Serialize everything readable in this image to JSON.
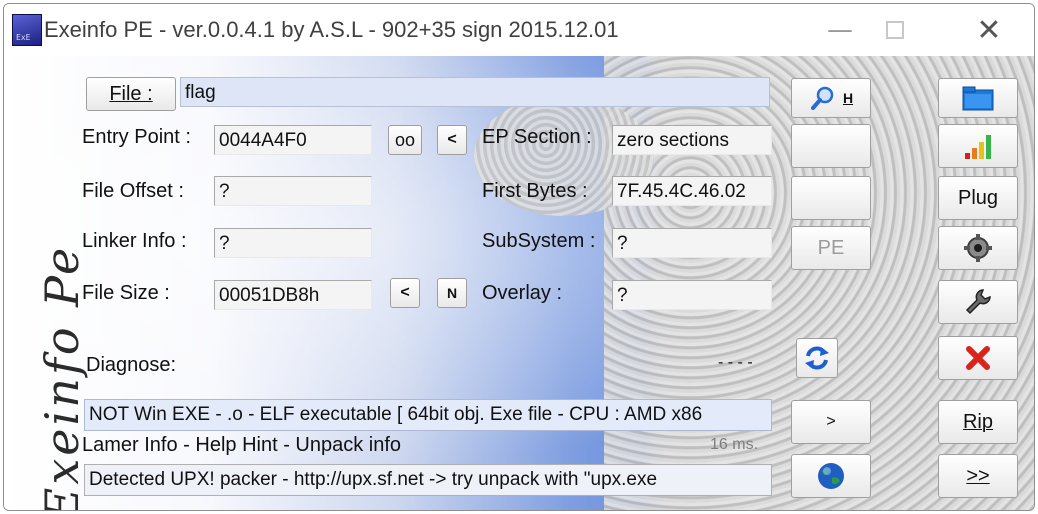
{
  "window": {
    "title": "Exeinfo PE - ver.0.0.4.1  by A.S.L -  902+35 sign  2015.12.01",
    "app_icon_text": "ExE",
    "min_glyph": "—",
    "close_glyph": "✕"
  },
  "logo": {
    "text": "Exeinfo Pe"
  },
  "file": {
    "button_label": "File :",
    "value": "flag"
  },
  "fields": {
    "entry_point_label": "Entry Point :",
    "entry_point_value": "0044A4F0",
    "oo_button": "oo",
    "ep_prev_button": "<",
    "ep_section_label": "EP Section :",
    "ep_section_value": "zero sections",
    "file_offset_label": "File Offset :",
    "file_offset_value": "?",
    "first_bytes_label": "First Bytes :",
    "first_bytes_value": "7F.45.4C.46.02",
    "linker_info_label": "Linker Info :",
    "linker_info_value": "?",
    "subsystem_label": "SubSystem :",
    "subsystem_value": "?",
    "file_size_label": "File Size :",
    "file_size_value": "00051DB8h",
    "size_prev_button": "<",
    "size_n_button": "N",
    "overlay_label": "Overlay :",
    "overlay_value": "?"
  },
  "diagnose": {
    "label": "Diagnose:",
    "dashes": "- - - -",
    "result": "NOT Win EXE - .o - ELF executable [ 64bit obj. Exe file - CPU : AMD x86"
  },
  "lamer": {
    "label": "Lamer Info - Help Hint - Unpack info",
    "timing": "16 ms.",
    "hint": "Detected UPX! packer - http://upx.sf.net -> try unpack with \"upx.exe"
  },
  "middle_buttons": {
    "search_h": "H",
    "pe_label": "PE",
    "next_label": ">"
  },
  "right_buttons": {
    "plug_label": "Plug",
    "rip_label": "Rip",
    "more_label": ">>"
  },
  "colors": {
    "accent_blue": "#6c8fdf",
    "close_red": "#d9231b",
    "globe_blue": "#1f5fbf"
  }
}
